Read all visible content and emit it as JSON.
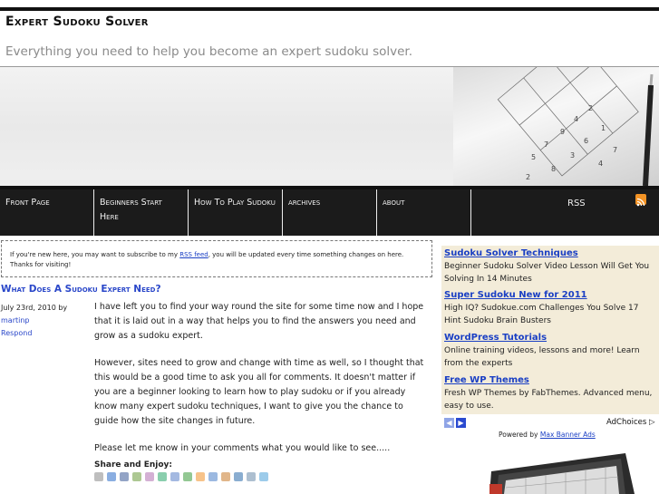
{
  "site": {
    "title": "Expert Sudoku Solver",
    "tagline": "Everything you need to help you become an expert sudoku solver."
  },
  "nav": {
    "items": [
      {
        "label": "Front Page"
      },
      {
        "label": "Beginners Start Here"
      },
      {
        "label": "How To Play Sudoku"
      },
      {
        "label": "archives"
      },
      {
        "label": "about"
      },
      {
        "label": "RSS"
      }
    ]
  },
  "notice": {
    "before": "If you're new here, you may want to subscribe to my ",
    "link": "RSS feed",
    "after": ", you will be updated every time something changes on here. Thanks for visiting!"
  },
  "post": {
    "title": "What Does A Sudoku Expert Need?",
    "date": "July 23rd, 2010 by",
    "author": "martinp",
    "respond": "Respond",
    "paragraphs": [
      "I have left you to find your way round the site for some time now and I hope that it is laid out in a way that helps you to find the answers you need and grow as a sudoku expert.",
      "However, sites need to grow and change with time as well, so I thought that this would be a good time to ask you all for comments. It doesn't matter if you are a beginner looking to learn how to play sudoku or if you already know many expert sudoku techniques, I want to give you the chance to guide how the site changes in future.",
      "Please let me know in your comments what you would like to see....."
    ],
    "share_label": "Share and Enjoy:"
  },
  "ads": {
    "items": [
      {
        "title": "Sudoku Solver Techniques",
        "desc": "Beginner Sudoku Solver Video Lesson Will Get You Solving In 14 Minutes"
      },
      {
        "title": "Super Sudoku New for 2011",
        "desc": "High IQ? Sudokue.com Challenges You Solve 17 Hint Sudoku Brain Busters"
      },
      {
        "title": "WordPress Tutorials",
        "desc": "Online training videos, lessons and more! Learn from the experts"
      },
      {
        "title": "Free WP Themes",
        "desc": "Fresh WP Themes by FabThemes. Advanced menu, easy to use."
      }
    ],
    "adchoices": "AdChoices",
    "powered_by": "Powered by",
    "powered_link": "Max Banner Ads"
  },
  "colors": {
    "link": "#2a47c9",
    "nav_bg": "#1b1b1b",
    "ad_bg": "#f3ecd9",
    "rss": "#f39325"
  }
}
